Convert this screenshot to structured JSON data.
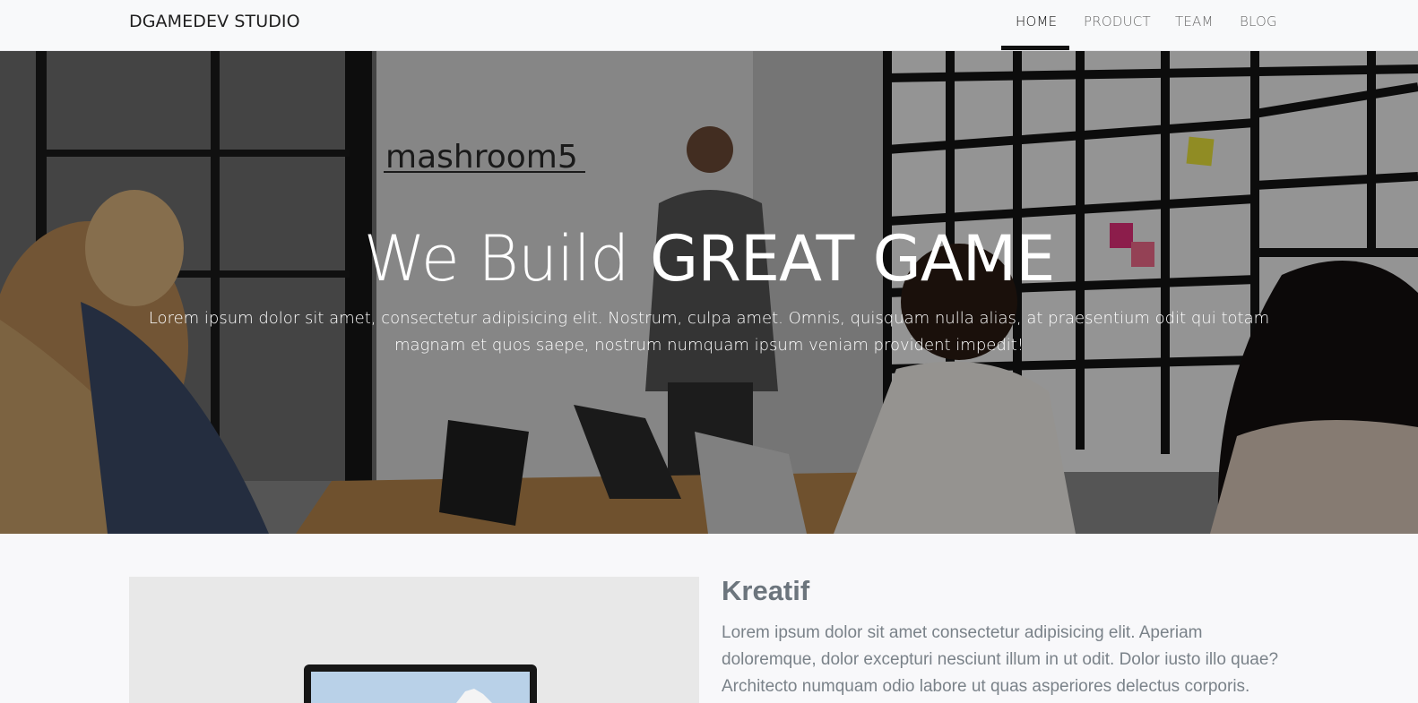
{
  "navbar": {
    "brand": "DGAMEDEV STUDIO",
    "links": [
      {
        "label": "HOME",
        "active": true
      },
      {
        "label": "PRODUCT",
        "active": false
      },
      {
        "label": "TEAM",
        "active": false
      },
      {
        "label": "BLOG",
        "active": false
      }
    ]
  },
  "hero": {
    "title_light": "We Build",
    "title_bold": "GREAT GAME",
    "lead": "Lorem ipsum dolor sit amet, consectetur adipisicing elit. Nostrum, culpa amet. Omnis, quisquam nulla alias, at praesentium odit qui totam magnam et quos saepe, nostrum numquam ipsum veniam provident impedit!",
    "image_sign": "mashroom5"
  },
  "feature": {
    "title": "Kreatif",
    "text": "Lorem ipsum dolor sit amet consectetur adipisicing elit. Aperiam doloremque, dolor excepturi nesciunt illum in ut odit. Dolor iusto illo quae? Architecto numquam odio labore ut quas asperiores delectus corporis."
  },
  "colors": {
    "navbar_bg": "#f8f9fa",
    "page_bg": "#f8f8fa",
    "feature_title": "#6c757d",
    "active_indicator": "#111111"
  }
}
